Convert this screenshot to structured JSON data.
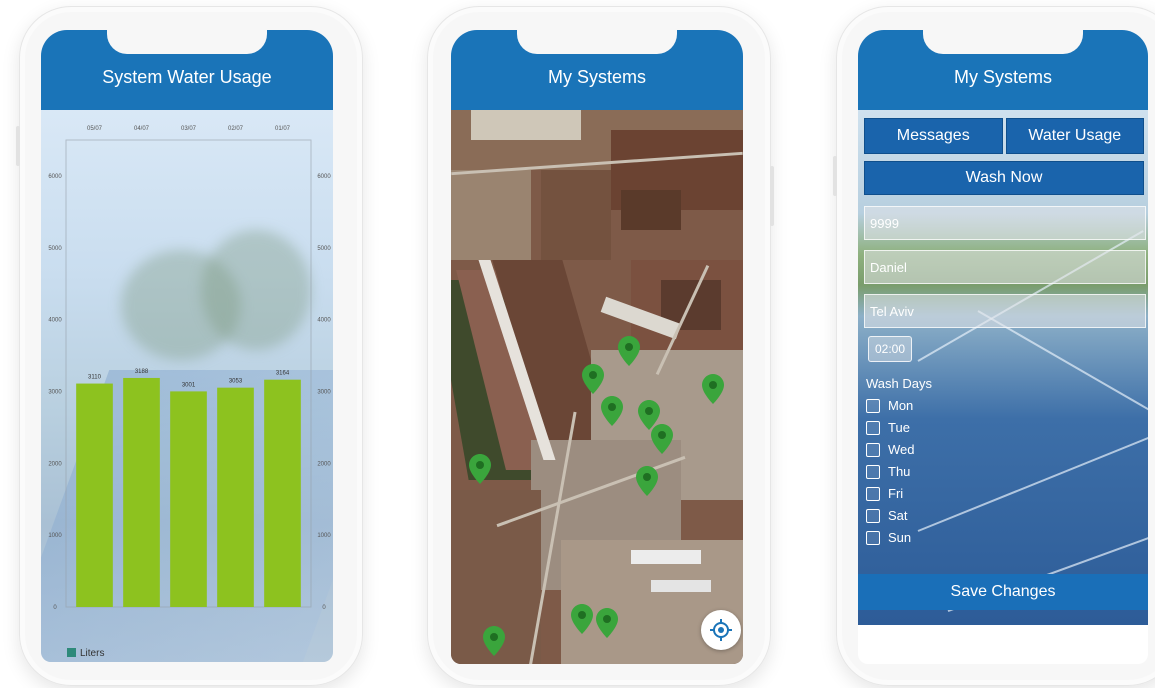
{
  "screens": {
    "usage": {
      "title": "System Water Usage",
      "legend_label": "Liters",
      "legend_color": "#2e8a7a"
    },
    "map": {
      "title": "My Systems",
      "locate_icon": "crosshair-icon",
      "pin_color": "#3aa53c"
    },
    "settings": {
      "title": "My Systems",
      "tabs": [
        {
          "label": "Messages"
        },
        {
          "label": "Water Usage"
        }
      ],
      "wash_now_label": "Wash Now",
      "fields": [
        {
          "value": "9999"
        },
        {
          "value": "Daniel"
        },
        {
          "value": "Tel Aviv"
        }
      ],
      "time_value": "02:00",
      "wash_days_label": "Wash Days",
      "days": [
        {
          "label": "Mon",
          "checked": false
        },
        {
          "label": "Tue",
          "checked": false
        },
        {
          "label": "Wed",
          "checked": false
        },
        {
          "label": "Thu",
          "checked": false
        },
        {
          "label": "Fri",
          "checked": false
        },
        {
          "label": "Sat",
          "checked": false
        },
        {
          "label": "Sun",
          "checked": false
        }
      ],
      "save_label": "Save Changes"
    }
  },
  "colors": {
    "header_blue": "#1a74b8",
    "button_blue": "#1a64ac",
    "bar_green": "#8dc21f"
  },
  "chart_data": {
    "type": "bar",
    "categories": [
      "05/07",
      "04/07",
      "03/07",
      "02/07",
      "01/07"
    ],
    "series": [
      {
        "name": "Liters",
        "values": [
          3110,
          3188,
          3001,
          3053,
          3164
        ]
      }
    ],
    "data_labels": [
      "3110",
      "3188",
      "3001",
      "3053",
      "3164"
    ],
    "y_ticks": [
      "0",
      "1000",
      "2000",
      "3000",
      "4000",
      "5000",
      "6000"
    ],
    "ylim": [
      0,
      6500
    ],
    "x_axis_position": "top",
    "y_axis": "both sides",
    "legend": "bottom-left",
    "grid": false
  }
}
